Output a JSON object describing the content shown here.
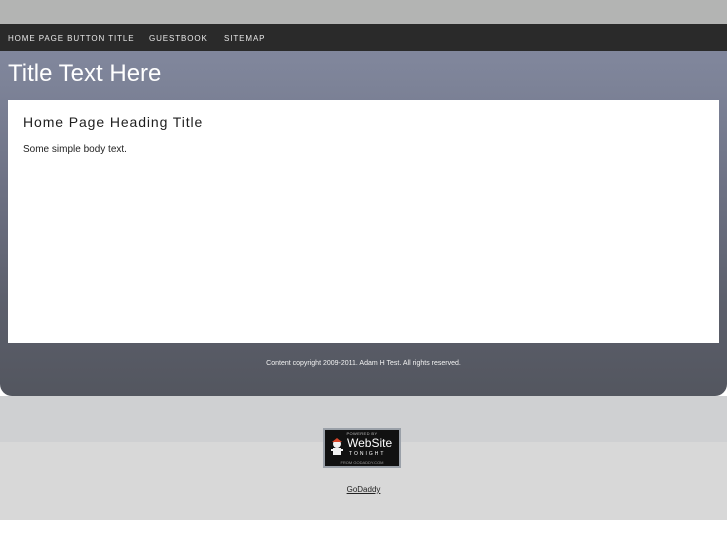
{
  "nav": {
    "items": [
      {
        "label": "HOME PAGE BUTTON TITLE"
      },
      {
        "label": "GUESTBOOK"
      },
      {
        "label": "SITEMAP"
      }
    ]
  },
  "header": {
    "title": "Title Text Here"
  },
  "main": {
    "heading": "Home Page Heading Title",
    "body": "Some simple body text."
  },
  "footer": {
    "copyright": "Content copyright 2009-2011. Adam H Test. All rights reserved.",
    "link": "GoDaddy"
  },
  "badge": {
    "top": "POWERED BY",
    "main": "WebSite",
    "sub": "TONIGHT",
    "bottom": "FROM GODADDY.COM",
    "icon": "website-tonight-mascot-icon"
  },
  "colors": {
    "navbar": "#2a2a2a",
    "header_top": "#848aa0",
    "header_bottom": "#53565f",
    "page_bg": "#cfd0d2"
  }
}
